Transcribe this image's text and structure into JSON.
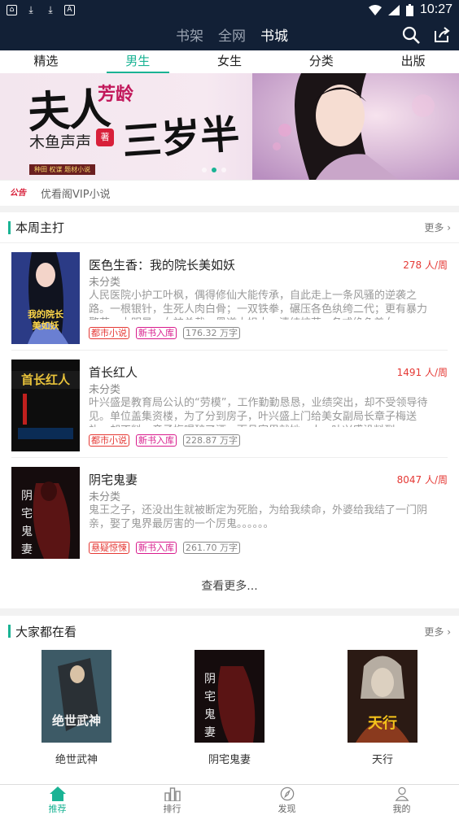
{
  "status_bar": {
    "time": "10:27"
  },
  "app_header": {
    "tabs": [
      {
        "label": "书架",
        "active": false
      },
      {
        "label": "全网",
        "active": false
      },
      {
        "label": "书城",
        "active": true
      }
    ],
    "icons": [
      "search-icon",
      "share-icon"
    ]
  },
  "category_tabs": [
    {
      "label": "精选",
      "active": false
    },
    {
      "label": "男生",
      "active": true
    },
    {
      "label": "女生",
      "active": false
    },
    {
      "label": "分类",
      "active": false
    },
    {
      "label": "出版",
      "active": false
    }
  ],
  "banner": {
    "title_part1": "夫人",
    "title_age": "芳龄",
    "title_part2": "三岁半",
    "author": "木鱼声声",
    "seal": "著",
    "ribbon": "种田 权谋 题材小说"
  },
  "notice": {
    "tag": "公告",
    "text": "优看阁VIP小说"
  },
  "weekly": {
    "title": "本周主打",
    "more": "更多 ›",
    "books": [
      {
        "name": "医色生香：我的院长美如妖",
        "readers": "278 人/周",
        "category": "未分类",
        "description": "人民医院小护工叶枫，偶得修仙大能传承，自此走上一条风骚的逆袭之路。一根银针，生死人肉白骨；一双铁拳，碾压各色纨绔二代；更有暴力警花、大明星、女神总裁、黑道大姐大，清纯校花...各式绝色美女",
        "tags": [
          "都市小说",
          "新书入库",
          "176.32 万字"
        ],
        "cover_text": "我的院长美如妖"
      },
      {
        "name": "首长红人",
        "readers": "1491 人/周",
        "category": "未分类",
        "description": "叶兴盛是教育局公认的“劳模”，工作勤勤恳恳，业绩突出，却不受领导待见。单位盖集资楼，为了分到房子，叶兴盛上门给美女副局长章子梅送礼，却不料，章子梅喝醉了酒，而且家里就她一人...叶兴盛没料到",
        "tags": [
          "都市小说",
          "新书入库",
          "228.87 万字"
        ],
        "cover_text": "首长红人"
      },
      {
        "name": "阴宅鬼妻",
        "readers": "8047 人/周",
        "category": "未分类",
        "description": "鬼王之子，还没出生就被断定为死胎，为给我续命，外婆给我结了一门阴亲，娶了鬼界最厉害的一个厉鬼。。。。。。",
        "tags": [
          "悬疑惊悚",
          "新书入库",
          "261.70 万字"
        ],
        "cover_text": "阴宅鬼妻"
      }
    ],
    "see_more": "查看更多..."
  },
  "popular": {
    "title": "大家都在看",
    "more": "更多 ›",
    "books": [
      {
        "name": "绝世武神",
        "cover_text": "绝世武神"
      },
      {
        "name": "阴宅鬼妻",
        "cover_text": "阴宅鬼妻"
      },
      {
        "name": "天行",
        "cover_text": "天行"
      }
    ]
  },
  "bottom_nav": [
    {
      "label": "推荐",
      "icon": "home-icon",
      "active": true
    },
    {
      "label": "排行",
      "icon": "ranking-icon",
      "active": false
    },
    {
      "label": "发现",
      "icon": "compass-icon",
      "active": false
    },
    {
      "label": "我的",
      "icon": "person-icon",
      "active": false
    }
  ],
  "colors": {
    "accent": "#1ab394",
    "header_bg": "#122036",
    "readers_red": "#e53935"
  }
}
